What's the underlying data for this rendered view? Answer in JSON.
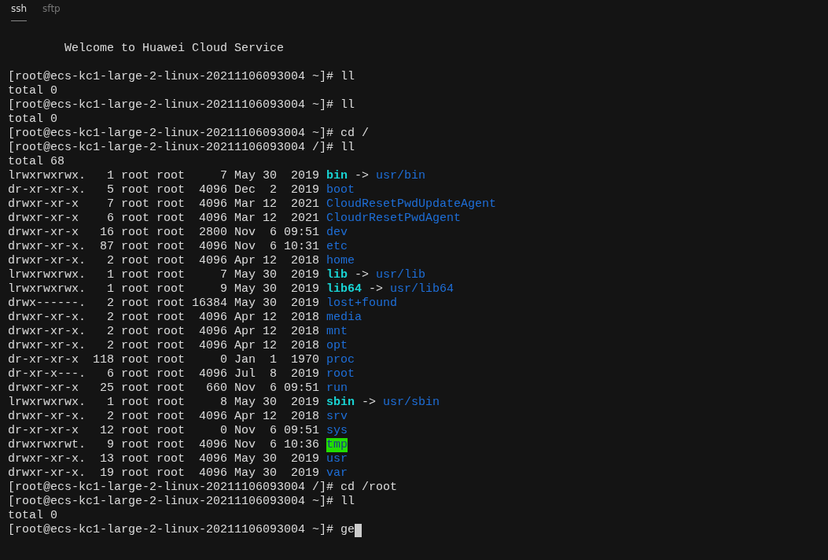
{
  "tabs": [
    {
      "label": "ssh",
      "selected": true
    },
    {
      "label": "sftp",
      "selected": false
    }
  ],
  "terminal": {
    "lines": [
      {
        "kind": "blank"
      },
      {
        "kind": "banner",
        "segments": [
          {
            "kind": "plain",
            "text": "Welcome to Huawei Cloud Service"
          }
        ]
      },
      {
        "kind": "blank"
      },
      {
        "kind": "text",
        "segments": [
          {
            "kind": "plain",
            "text": "[root@ecs-kc1-large-2-linux-20211106093004 ~]# ll"
          }
        ]
      },
      {
        "kind": "text",
        "segments": [
          {
            "kind": "plain",
            "text": "total 0"
          }
        ]
      },
      {
        "kind": "text",
        "segments": [
          {
            "kind": "plain",
            "text": "[root@ecs-kc1-large-2-linux-20211106093004 ~]# ll"
          }
        ]
      },
      {
        "kind": "text",
        "segments": [
          {
            "kind": "plain",
            "text": "total 0"
          }
        ]
      },
      {
        "kind": "text",
        "segments": [
          {
            "kind": "plain",
            "text": "[root@ecs-kc1-large-2-linux-20211106093004 ~]# cd /"
          }
        ]
      },
      {
        "kind": "text",
        "segments": [
          {
            "kind": "plain",
            "text": "[root@ecs-kc1-large-2-linux-20211106093004 /]# ll"
          }
        ]
      },
      {
        "kind": "text",
        "segments": [
          {
            "kind": "plain",
            "text": "total 68"
          }
        ]
      },
      {
        "kind": "text",
        "segments": [
          {
            "kind": "plain",
            "text": "lrwxrwxrwx.   1 root root     7 May 30  2019 "
          },
          {
            "kind": "symlink",
            "text": "bin"
          },
          {
            "kind": "plain",
            "text": " -> "
          },
          {
            "kind": "dir",
            "text": "usr/bin"
          }
        ]
      },
      {
        "kind": "text",
        "segments": [
          {
            "kind": "plain",
            "text": "dr-xr-xr-x.   5 root root  4096 Dec  2  2019 "
          },
          {
            "kind": "dir",
            "text": "boot"
          }
        ]
      },
      {
        "kind": "text",
        "segments": [
          {
            "kind": "plain",
            "text": "drwxr-xr-x    7 root root  4096 Mar 12  2021 "
          },
          {
            "kind": "dir",
            "text": "CloudResetPwdUpdateAgent"
          }
        ]
      },
      {
        "kind": "text",
        "segments": [
          {
            "kind": "plain",
            "text": "drwxr-xr-x    6 root root  4096 Mar 12  2021 "
          },
          {
            "kind": "dir",
            "text": "CloudrResetPwdAgent"
          }
        ]
      },
      {
        "kind": "text",
        "segments": [
          {
            "kind": "plain",
            "text": "drwxr-xr-x   16 root root  2800 Nov  6 09:51 "
          },
          {
            "kind": "dir",
            "text": "dev"
          }
        ]
      },
      {
        "kind": "text",
        "segments": [
          {
            "kind": "plain",
            "text": "drwxr-xr-x.  87 root root  4096 Nov  6 10:31 "
          },
          {
            "kind": "dir",
            "text": "etc"
          }
        ]
      },
      {
        "kind": "text",
        "segments": [
          {
            "kind": "plain",
            "text": "drwxr-xr-x.   2 root root  4096 Apr 12  2018 "
          },
          {
            "kind": "dir",
            "text": "home"
          }
        ]
      },
      {
        "kind": "text",
        "segments": [
          {
            "kind": "plain",
            "text": "lrwxrwxrwx.   1 root root     7 May 30  2019 "
          },
          {
            "kind": "symlink",
            "text": "lib"
          },
          {
            "kind": "plain",
            "text": " -> "
          },
          {
            "kind": "dir",
            "text": "usr/lib"
          }
        ]
      },
      {
        "kind": "text",
        "segments": [
          {
            "kind": "plain",
            "text": "lrwxrwxrwx.   1 root root     9 May 30  2019 "
          },
          {
            "kind": "symlink",
            "text": "lib64"
          },
          {
            "kind": "plain",
            "text": " -> "
          },
          {
            "kind": "dir",
            "text": "usr/lib64"
          }
        ]
      },
      {
        "kind": "text",
        "segments": [
          {
            "kind": "plain",
            "text": "drwx------.   2 root root 16384 May 30  2019 "
          },
          {
            "kind": "dir",
            "text": "lost+found"
          }
        ]
      },
      {
        "kind": "text",
        "segments": [
          {
            "kind": "plain",
            "text": "drwxr-xr-x.   2 root root  4096 Apr 12  2018 "
          },
          {
            "kind": "dir",
            "text": "media"
          }
        ]
      },
      {
        "kind": "text",
        "segments": [
          {
            "kind": "plain",
            "text": "drwxr-xr-x.   2 root root  4096 Apr 12  2018 "
          },
          {
            "kind": "dir",
            "text": "mnt"
          }
        ]
      },
      {
        "kind": "text",
        "segments": [
          {
            "kind": "plain",
            "text": "drwxr-xr-x.   2 root root  4096 Apr 12  2018 "
          },
          {
            "kind": "dir",
            "text": "opt"
          }
        ]
      },
      {
        "kind": "text",
        "segments": [
          {
            "kind": "plain",
            "text": "dr-xr-xr-x  118 root root     0 Jan  1  1970 "
          },
          {
            "kind": "dir",
            "text": "proc"
          }
        ]
      },
      {
        "kind": "text",
        "segments": [
          {
            "kind": "plain",
            "text": "dr-xr-x---.   6 root root  4096 Jul  8  2019 "
          },
          {
            "kind": "dir",
            "text": "root"
          }
        ]
      },
      {
        "kind": "text",
        "segments": [
          {
            "kind": "plain",
            "text": "drwxr-xr-x   25 root root   660 Nov  6 09:51 "
          },
          {
            "kind": "dir",
            "text": "run"
          }
        ]
      },
      {
        "kind": "text",
        "segments": [
          {
            "kind": "plain",
            "text": "lrwxrwxrwx.   1 root root     8 May 30  2019 "
          },
          {
            "kind": "symlink",
            "text": "sbin"
          },
          {
            "kind": "plain",
            "text": " -> "
          },
          {
            "kind": "dir",
            "text": "usr/sbin"
          }
        ]
      },
      {
        "kind": "text",
        "segments": [
          {
            "kind": "plain",
            "text": "drwxr-xr-x.   2 root root  4096 Apr 12  2018 "
          },
          {
            "kind": "dir",
            "text": "srv"
          }
        ]
      },
      {
        "kind": "text",
        "segments": [
          {
            "kind": "plain",
            "text": "dr-xr-xr-x   12 root root     0 Nov  6 09:51 "
          },
          {
            "kind": "dir",
            "text": "sys"
          }
        ]
      },
      {
        "kind": "text",
        "segments": [
          {
            "kind": "plain",
            "text": "drwxrwxrwt.   9 root root  4096 Nov  6 10:36 "
          },
          {
            "kind": "sticky",
            "text": "tmp"
          }
        ]
      },
      {
        "kind": "text",
        "segments": [
          {
            "kind": "plain",
            "text": "drwxr-xr-x.  13 root root  4096 May 30  2019 "
          },
          {
            "kind": "dir",
            "text": "usr"
          }
        ]
      },
      {
        "kind": "text",
        "segments": [
          {
            "kind": "plain",
            "text": "drwxr-xr-x.  19 root root  4096 May 30  2019 "
          },
          {
            "kind": "dir",
            "text": "var"
          }
        ]
      },
      {
        "kind": "text",
        "segments": [
          {
            "kind": "plain",
            "text": "[root@ecs-kc1-large-2-linux-20211106093004 /]# cd /root"
          }
        ]
      },
      {
        "kind": "text",
        "segments": [
          {
            "kind": "plain",
            "text": "[root@ecs-kc1-large-2-linux-20211106093004 ~]# ll"
          }
        ]
      },
      {
        "kind": "text",
        "segments": [
          {
            "kind": "plain",
            "text": "total 0"
          }
        ]
      },
      {
        "kind": "prompt",
        "segments": [
          {
            "kind": "plain",
            "text": "[root@ecs-kc1-large-2-linux-20211106093004 ~]# ge"
          }
        ]
      }
    ]
  }
}
